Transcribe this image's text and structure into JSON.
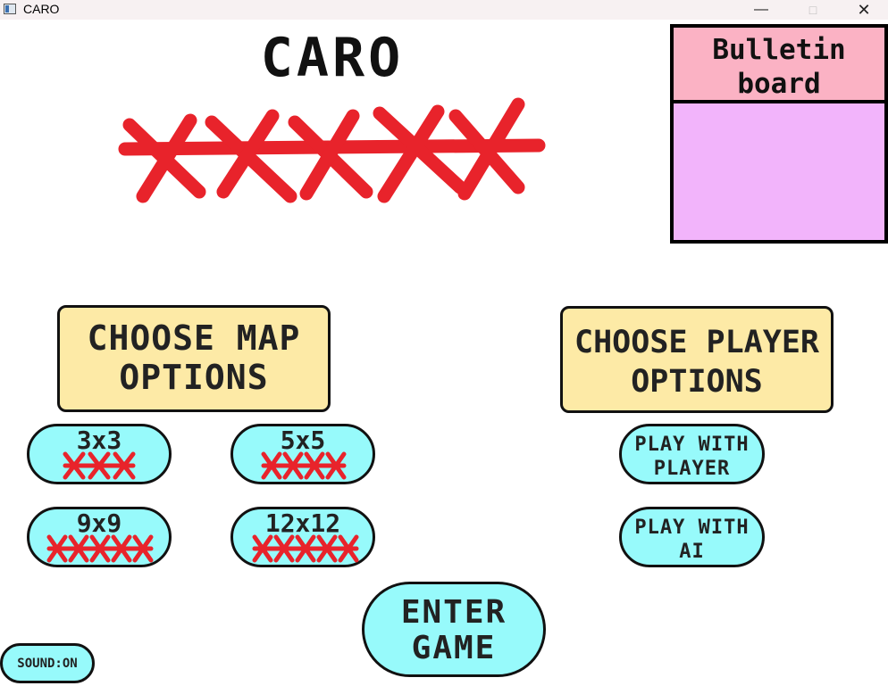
{
  "window": {
    "title": "CARO",
    "min_icon": "minimize-icon",
    "max_icon": "maximize-icon",
    "close_icon": "close-icon"
  },
  "title": {
    "text": "CARO",
    "x_color": "#e8232b"
  },
  "bulletin": {
    "label_line1": "Bulletin",
    "label_line2": "board",
    "header_color": "#fbb2c4",
    "body_color": "#f2b4fb"
  },
  "map_options": {
    "label_line1": "CHOOSE MAP",
    "label_line2": "OPTIONS",
    "maps": [
      {
        "size": "3x3",
        "marks": "XXX"
      },
      {
        "size": "5x5",
        "marks": "XXXX"
      },
      {
        "size": "9x9",
        "marks": "XXXXX"
      },
      {
        "size": "12x12",
        "marks": "XXXXX"
      }
    ]
  },
  "player_options": {
    "label_line1": "CHOOSE PLAYER",
    "label_line2": "OPTIONS",
    "player": {
      "line1": "PLAY WITH",
      "line2": "PLAYER"
    },
    "ai": {
      "line1": "PLAY WITH",
      "line2": "AI"
    }
  },
  "enter": {
    "line1": "ENTER",
    "line2": "GAME"
  },
  "sound": {
    "label": "SOUND:ON"
  },
  "colors": {
    "button": "#97fafb",
    "option_box": "#fdeaa6",
    "mark": "#e8232b"
  }
}
